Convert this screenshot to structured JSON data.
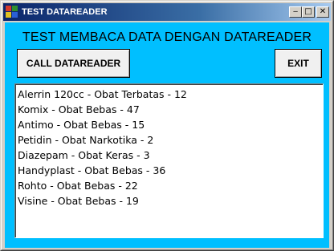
{
  "window": {
    "title": "TEST DATAREADER",
    "minimize_glyph": "‒",
    "maximize_glyph": "□",
    "close_glyph": "✕"
  },
  "main": {
    "heading": "TEST MEMBACA DATA DENGAN DATAREADER",
    "call_button_label": "CALL DATAREADER",
    "exit_button_label": "EXIT",
    "list_items": [
      "Alerrin 120cc - Obat Terbatas - 12",
      "Komix - Obat Bebas - 47",
      "Antimo - Obat Bebas - 15",
      "Petidin - Obat Narkotika - 2",
      "Diazepam - Obat Keras - 3",
      "Handyplast - Obat Bebas - 36",
      "Rohto - Obat Bebas - 22",
      "Visine - Obat Bebas - 19"
    ]
  },
  "colors": {
    "client_background": "#00bfff",
    "titlebar_start": "#0a246a",
    "titlebar_end": "#a6caf0"
  }
}
